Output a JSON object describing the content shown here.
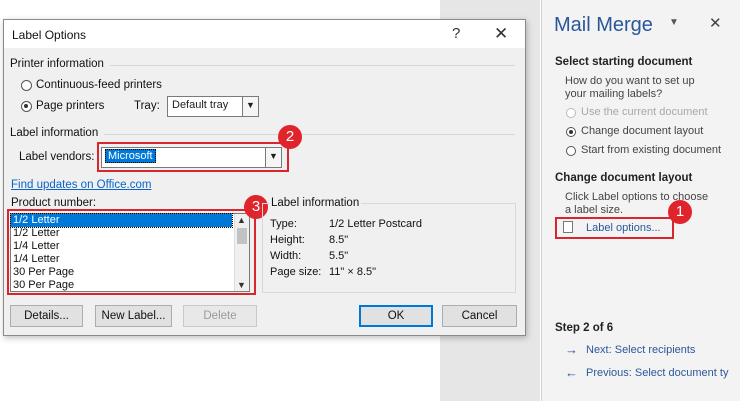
{
  "dialog": {
    "title": "Label Options",
    "help_icon": "?",
    "close_icon": "✕",
    "printer_section": "Printer information",
    "continuous_feed": "Continuous-feed printers",
    "page_printers": "Page printers",
    "tray_label": "Tray:",
    "tray_value": "Default tray",
    "label_section": "Label information",
    "vendor_label": "Label vendors:",
    "vendor_value": "Microsoft",
    "find_updates": "Find updates on Office.com",
    "product_number_label": "Product number:",
    "products": [
      "1/2 Letter",
      "1/2 Letter",
      "1/4 Letter",
      "1/4 Letter",
      "30 Per Page",
      "30 Per Page"
    ],
    "selected_product_index": 0,
    "info_box_title": "Label information",
    "info": [
      {
        "key": "Type:",
        "value": "1/2 Letter Postcard"
      },
      {
        "key": "Height:",
        "value": "8.5\""
      },
      {
        "key": "Width:",
        "value": "5.5\""
      },
      {
        "key": "Page size:",
        "value": "11\" × 8.5\""
      }
    ],
    "buttons": {
      "details": "Details...",
      "new_label": "New Label...",
      "delete": "Delete",
      "ok": "OK",
      "cancel": "Cancel"
    }
  },
  "pane": {
    "title": "Mail Merge",
    "select_doc_heading": "Select starting document",
    "select_doc_question_1": "How do you want to set up",
    "select_doc_question_2": "your mailing labels?",
    "options": [
      {
        "label": "Use the current document",
        "disabled": true,
        "selected": false
      },
      {
        "label": "Change document layout",
        "disabled": false,
        "selected": true
      },
      {
        "label": "Start from existing document",
        "disabled": false,
        "selected": false
      }
    ],
    "change_layout_heading": "Change document layout",
    "change_layout_text_1": "Click Label options to choose",
    "change_layout_text_2": "a label size.",
    "label_options_link": "Label options...",
    "step": "Step 2 of 6",
    "next_link": "Next: Select recipients",
    "prev_link": "Previous: Select document ty"
  },
  "callouts": {
    "one": "1",
    "two": "2",
    "three": "3"
  },
  "colors": {
    "accent": "#2b579a",
    "callout": "#d9262e",
    "selection": "#0078d7"
  }
}
